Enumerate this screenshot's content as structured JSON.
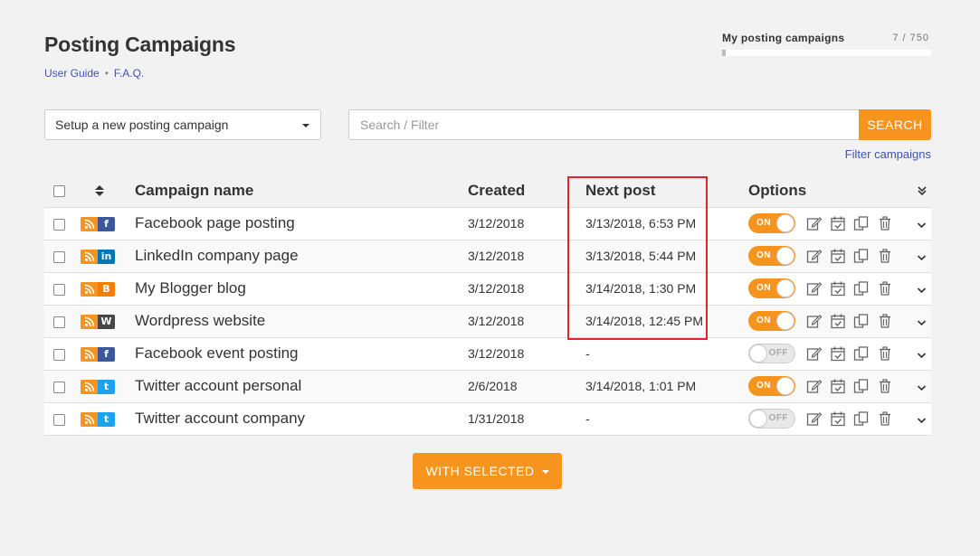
{
  "header": {
    "title": "Posting Campaigns",
    "user_guide": "User Guide",
    "separator": "•",
    "faq": "F.A.Q."
  },
  "quota": {
    "label": "My posting campaigns",
    "count": "7 / 750",
    "used_fraction": 0.0093
  },
  "toolbar": {
    "new_campaign_select": "Setup a new posting campaign",
    "search_placeholder": "Search / Filter",
    "search_button": "SEARCH",
    "filter_link": "Filter campaigns"
  },
  "table": {
    "headers": {
      "name": "Campaign name",
      "created": "Created",
      "next_post": "Next post",
      "options": "Options"
    },
    "rows": [
      {
        "network": "facebook",
        "network_color": "#3b5998",
        "network_glyph": "f",
        "name": "Facebook page posting",
        "created": "3/12/2018",
        "next_post": "3/13/2018, 6:53 PM",
        "toggle": "ON"
      },
      {
        "network": "linkedin",
        "network_color": "#0077b5",
        "network_glyph": "in",
        "name": "LinkedIn company page",
        "created": "3/12/2018",
        "next_post": "3/13/2018, 5:44 PM",
        "toggle": "ON"
      },
      {
        "network": "blogger",
        "network_color": "#f57d00",
        "network_glyph": "B",
        "name": "My Blogger blog",
        "created": "3/12/2018",
        "next_post": "3/14/2018, 1:30 PM",
        "toggle": "ON"
      },
      {
        "network": "wordpress",
        "network_color": "#464646",
        "network_glyph": "W",
        "name": "Wordpress website",
        "created": "3/12/2018",
        "next_post": "3/14/2018, 12:45 PM",
        "toggle": "ON"
      },
      {
        "network": "facebook",
        "network_color": "#3b5998",
        "network_glyph": "f",
        "name": "Facebook event posting",
        "created": "3/12/2018",
        "next_post": "-",
        "toggle": "OFF"
      },
      {
        "network": "twitter",
        "network_color": "#1da1f2",
        "network_glyph": "t",
        "name": "Twitter account personal",
        "created": "2/6/2018",
        "next_post": "3/14/2018, 1:01 PM",
        "toggle": "ON"
      },
      {
        "network": "twitter",
        "network_color": "#1da1f2",
        "network_glyph": "t",
        "name": "Twitter account company",
        "created": "1/31/2018",
        "next_post": "-",
        "toggle": "OFF"
      }
    ]
  },
  "footer": {
    "with_selected": "WITH SELECTED"
  },
  "colors": {
    "accent": "#f7941d",
    "link": "#3f51b5",
    "highlight_box": "#e0242b"
  }
}
